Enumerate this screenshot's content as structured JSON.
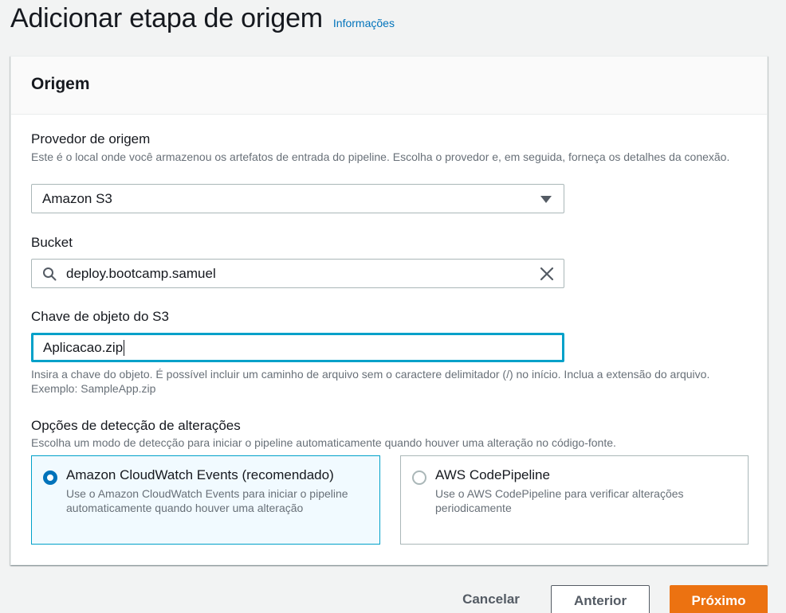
{
  "header": {
    "title": "Adicionar etapa de origem",
    "info_link": "Informações"
  },
  "panel": {
    "title": "Origem",
    "provider": {
      "label": "Provedor de origem",
      "description": "Este é o local onde você armazenou os artefatos de entrada do pipeline. Escolha o provedor e, em seguida, forneça os detalhes da conexão.",
      "selected_value": "Amazon S3"
    },
    "bucket": {
      "label": "Bucket",
      "value": "deploy.bootcamp.samuel"
    },
    "object_key": {
      "label": "Chave de objeto do S3",
      "value": "Aplicacao.zip",
      "hint": "Insira a chave do objeto. É possível incluir um caminho de arquivo sem o caractere delimitador (/) no início. Inclua a extensão do arquivo. Exemplo: SampleApp.zip"
    },
    "detection": {
      "label": "Opções de detecção de alterações",
      "description": "Escolha um modo de detecção para iniciar o pipeline automaticamente quando houver uma alteração no código-fonte.",
      "options": [
        {
          "title": "Amazon CloudWatch Events (recomendado)",
          "description": "Use o Amazon CloudWatch Events para iniciar o pipeline automaticamente quando houver uma alteração",
          "selected": true
        },
        {
          "title": "AWS CodePipeline",
          "description": "Use o AWS CodePipeline para verificar alterações periodicamente",
          "selected": false
        }
      ]
    }
  },
  "actions": {
    "cancel": "Cancelar",
    "previous": "Anterior",
    "next": "Próximo"
  },
  "icons": {
    "search": "search-icon",
    "clear": "close-icon",
    "dropdown": "caret-down-icon"
  },
  "colors": {
    "primary": "#ec7211",
    "link": "#0073bb",
    "focus": "#00a1c9",
    "selected_tile_bg": "#f1faff"
  }
}
